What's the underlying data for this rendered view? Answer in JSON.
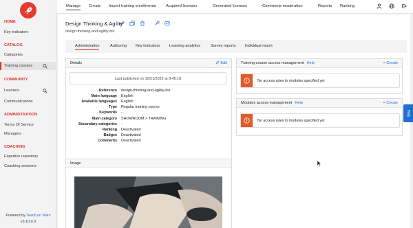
{
  "sidebar": {
    "home": "HOME",
    "key_indicators": "Key indicators",
    "catalog": "CATALOG",
    "categories": "Categories",
    "training_courses": "Training courses",
    "community": "COMMUNITY",
    "learners": "Learners",
    "communications": "Communications",
    "administration": "ADMINISTRATION",
    "terms": "Terms Of Service",
    "managers": "Managers",
    "coaching": "COACHING",
    "expertise": "Expertise repository",
    "coaching_sessions": "Coaching sessions",
    "powered_by": "Powered by",
    "brand": "Teach on Mars",
    "version": "v3.10.0.0"
  },
  "topnav": [
    "Manage",
    "Create",
    "Import training enrollments",
    "Acquired licenses",
    "Generated licenses",
    "Comments moderation",
    "Reports",
    "Ranking"
  ],
  "page": {
    "title": "Design Thinking & Agility",
    "reference": "design-thinking-and-agility-bis"
  },
  "tabs": [
    "Administration",
    "Authoring",
    "Key indicators",
    "Learning analytics",
    "Survey reports",
    "Individual report"
  ],
  "details": {
    "title": "Details",
    "edit": "Edit",
    "published": "Last published on 10/21/2022 at 8:45:18",
    "rows": [
      {
        "k": "Reference",
        "v": "design-thinking-and-agility-bis"
      },
      {
        "k": "Main language",
        "v": "English"
      },
      {
        "k": "Available languages",
        "v": "English"
      },
      {
        "k": "Type",
        "v": "Regular training course"
      },
      {
        "k": "Keywords",
        "v": "-"
      },
      {
        "k": "Main category",
        "v": "SHOWROOM > TRAINING"
      },
      {
        "k": "Secondary categories",
        "v": "-"
      },
      {
        "k": "Ranking",
        "v": "Deactivated"
      },
      {
        "k": "Badges",
        "v": "Deactivated"
      },
      {
        "k": "Comments",
        "v": "Deactivated"
      }
    ]
  },
  "image_panel": {
    "title": "Image"
  },
  "tc_access": {
    "title": "Training course access management",
    "help": "Help",
    "create": "+ Create",
    "message": "No access rules to modules specified yet"
  },
  "mod_access": {
    "title": "Modules access management",
    "help": "Help",
    "create": "+ Create",
    "message": "No access rules to modules specified yet"
  },
  "help_tab": "Help",
  "colors": {
    "brand": "#d9342b",
    "link": "#1e6fd0",
    "alert": "#e35a28"
  }
}
